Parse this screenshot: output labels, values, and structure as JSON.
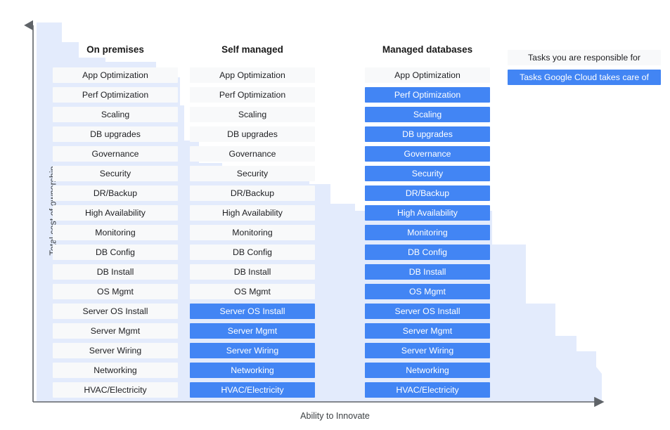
{
  "axes": {
    "y_label": "Total cost of ownership",
    "x_label": "Ability to Innovate"
  },
  "colors": {
    "filled": "#4285f4",
    "unfilled": "#f8f9fa",
    "background_area": "#e3ebfc",
    "axis_line": "#5f6368"
  },
  "legend": {
    "items": [
      {
        "label": "Tasks you are responsible for",
        "filled": false
      },
      {
        "label": "Tasks Google Cloud takes care of",
        "filled": true
      }
    ]
  },
  "columns": [
    {
      "title": "On premises",
      "rows": [
        {
          "label": "App Optimization",
          "filled": false
        },
        {
          "label": "Perf Optimization",
          "filled": false
        },
        {
          "label": "Scaling",
          "filled": false
        },
        {
          "label": "DB upgrades",
          "filled": false
        },
        {
          "label": "Governance",
          "filled": false
        },
        {
          "label": "Security",
          "filled": false
        },
        {
          "label": "DR/Backup",
          "filled": false
        },
        {
          "label": "High Availability",
          "filled": false
        },
        {
          "label": "Monitoring",
          "filled": false
        },
        {
          "label": "DB Config",
          "filled": false
        },
        {
          "label": "DB Install",
          "filled": false
        },
        {
          "label": "OS Mgmt",
          "filled": false
        },
        {
          "label": "Server OS Install",
          "filled": false
        },
        {
          "label": "Server Mgmt",
          "filled": false
        },
        {
          "label": "Server Wiring",
          "filled": false
        },
        {
          "label": "Networking",
          "filled": false
        },
        {
          "label": "HVAC/Electricity",
          "filled": false
        }
      ]
    },
    {
      "title": "Self managed",
      "rows": [
        {
          "label": "App Optimization",
          "filled": false
        },
        {
          "label": "Perf Optimization",
          "filled": false
        },
        {
          "label": "Scaling",
          "filled": false
        },
        {
          "label": "DB upgrades",
          "filled": false
        },
        {
          "label": "Governance",
          "filled": false
        },
        {
          "label": "Security",
          "filled": false
        },
        {
          "label": "DR/Backup",
          "filled": false
        },
        {
          "label": "High Availability",
          "filled": false
        },
        {
          "label": "Monitoring",
          "filled": false
        },
        {
          "label": "DB Config",
          "filled": false
        },
        {
          "label": "DB Install",
          "filled": false
        },
        {
          "label": "OS Mgmt",
          "filled": false
        },
        {
          "label": "Server OS Install",
          "filled": true
        },
        {
          "label": "Server Mgmt",
          "filled": true
        },
        {
          "label": "Server Wiring",
          "filled": true
        },
        {
          "label": "Networking",
          "filled": true
        },
        {
          "label": "HVAC/Electricity",
          "filled": true
        }
      ]
    },
    {
      "title": "Managed databases",
      "rows": [
        {
          "label": "App Optimization",
          "filled": false
        },
        {
          "label": "Perf Optimization",
          "filled": true
        },
        {
          "label": "Scaling",
          "filled": true
        },
        {
          "label": "DB upgrades",
          "filled": true
        },
        {
          "label": "Governance",
          "filled": true
        },
        {
          "label": "Security",
          "filled": true
        },
        {
          "label": "DR/Backup",
          "filled": true
        },
        {
          "label": "High Availability",
          "filled": true
        },
        {
          "label": "Monitoring",
          "filled": true
        },
        {
          "label": "DB Config",
          "filled": true
        },
        {
          "label": "DB Install",
          "filled": true
        },
        {
          "label": "OS Mgmt",
          "filled": true
        },
        {
          "label": "Server OS Install",
          "filled": true
        },
        {
          "label": "Server Mgmt",
          "filled": true
        },
        {
          "label": "Server Wiring",
          "filled": true
        },
        {
          "label": "Networking",
          "filled": true
        },
        {
          "label": "HVAC/Electricity",
          "filled": true
        }
      ]
    }
  ],
  "chart_data": {
    "type": "table",
    "title": "",
    "xlabel": "Ability to Innovate",
    "ylabel": "Total cost of ownership",
    "categories": [
      "On premises",
      "Self managed",
      "Managed databases"
    ],
    "task_rows": [
      "App Optimization",
      "Perf Optimization",
      "Scaling",
      "DB upgrades",
      "Governance",
      "Security",
      "DR/Backup",
      "High Availability",
      "Monitoring",
      "DB Config",
      "DB Install",
      "OS Mgmt",
      "Server OS Install",
      "Server Mgmt",
      "Server Wiring",
      "Networking",
      "HVAC/Electricity"
    ],
    "series": [
      {
        "name": "On premises",
        "values": [
          0,
          0,
          0,
          0,
          0,
          0,
          0,
          0,
          0,
          0,
          0,
          0,
          0,
          0,
          0,
          0,
          0
        ]
      },
      {
        "name": "Self managed",
        "values": [
          0,
          0,
          0,
          0,
          0,
          0,
          0,
          0,
          0,
          0,
          0,
          0,
          1,
          1,
          1,
          1,
          1
        ]
      },
      {
        "name": "Managed databases",
        "values": [
          0,
          1,
          1,
          1,
          1,
          1,
          1,
          1,
          1,
          1,
          1,
          1,
          1,
          1,
          1,
          1,
          1
        ]
      }
    ],
    "value_legend": {
      "0": "Tasks you are responsible for",
      "1": "Tasks Google Cloud takes care of"
    },
    "google_managed_counts": {
      "On premises": 0,
      "Self managed": 5,
      "Managed databases": 16
    },
    "background_trend": "descending staircase from upper-left to lower-right indicating total cost of ownership falls as ability to innovate rises",
    "grid": false,
    "legend_position": "top-right"
  }
}
